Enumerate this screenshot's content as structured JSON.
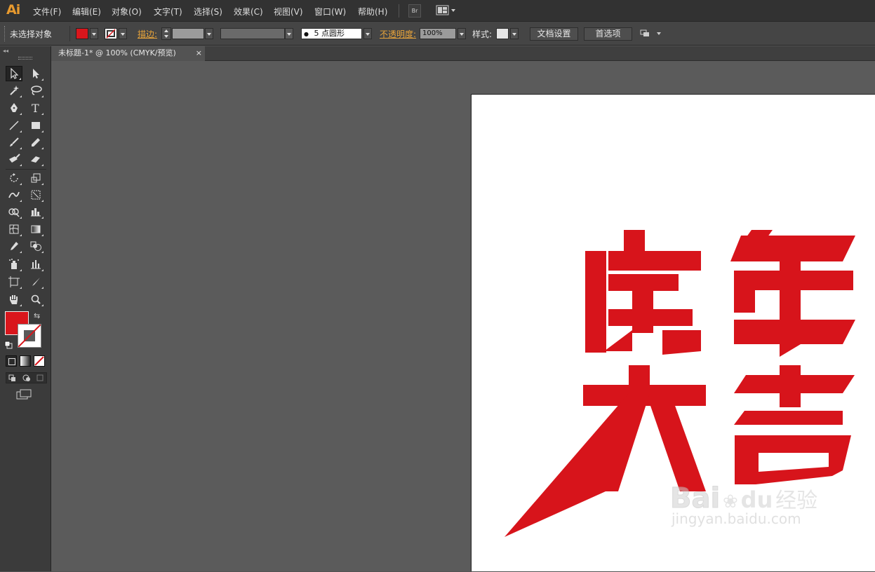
{
  "app": {
    "logo": "Ai"
  },
  "menu": {
    "items": [
      "文件(F)",
      "编辑(E)",
      "对象(O)",
      "文字(T)",
      "选择(S)",
      "效果(C)",
      "视图(V)",
      "窗口(W)",
      "帮助(H)"
    ],
    "bridge_label": "Br"
  },
  "control_bar": {
    "selection_status": "未选择对象",
    "stroke_label": "描边:",
    "brush_dot": "●",
    "brush_label": "5 点圆形",
    "opacity_label": "不透明度:",
    "opacity_value": "100%",
    "style_label": "样式:",
    "doc_setup_button": "文档设置",
    "preferences_button": "首选项"
  },
  "document_tab": {
    "title": "未标题-1* @ 100% (CMYK/预览)",
    "close": "×"
  },
  "colors": {
    "fill": "#d9161c",
    "artwork": "#d7141b",
    "accent": "#e8a43a"
  },
  "artwork": {
    "line1": "虎年",
    "line2": "大吉"
  },
  "watermark": {
    "brand": "Bai",
    "brand2": "du",
    "product": "经验",
    "url": "jingyan.baidu.com"
  },
  "icons": {
    "selection": "selection-tool-icon",
    "direct_selection": "direct-selection-tool-icon",
    "magic_wand": "magic-wand-icon",
    "lasso": "lasso-icon",
    "pen": "pen-icon",
    "type": "type-icon",
    "line": "line-icon",
    "rectangle": "rectangle-icon",
    "paintbrush": "paintbrush-icon",
    "pencil": "pencil-icon",
    "blob_brush": "blob-brush-icon",
    "eraser": "eraser-icon",
    "rotate": "rotate-icon",
    "scale": "scale-icon",
    "warp": "warp-icon",
    "free_transform": "free-transform-icon",
    "shape_builder": "shape-builder-icon",
    "graph": "graph-icon",
    "mesh": "mesh-icon",
    "gradient": "gradient-icon",
    "eyedropper": "eyedropper-icon",
    "blend": "blend-icon",
    "symbol_sprayer": "symbol-sprayer-icon",
    "column_graph": "column-graph-icon",
    "artboard": "artboard-icon",
    "slice": "slice-icon",
    "hand": "hand-icon",
    "zoom": "zoom-icon"
  }
}
